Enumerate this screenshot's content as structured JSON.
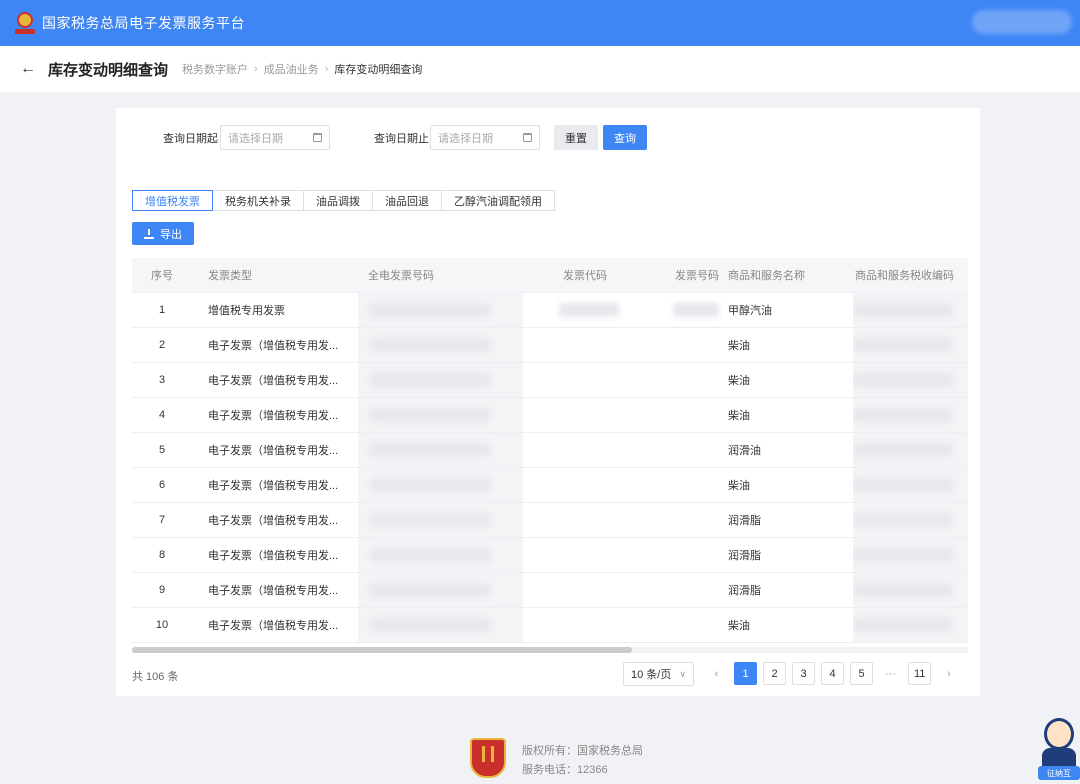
{
  "header": {
    "title": "国家税务总局电子发票服务平台"
  },
  "page": {
    "back_icon": "arrow-left-icon",
    "title": "库存变动明细查询",
    "breadcrumb": [
      "税务数字账户",
      "成品油业务",
      "库存变动明细查询"
    ],
    "breadcrumb_sep": "›"
  },
  "filters": {
    "start_label": "查询日期起",
    "start_placeholder": "请选择日期",
    "end_label": "查询日期止",
    "end_placeholder": "请选择日期",
    "reset_label": "重置",
    "query_label": "查询"
  },
  "tabs": [
    {
      "label": "增值税发票",
      "active": true
    },
    {
      "label": "税务机关补录",
      "active": false
    },
    {
      "label": "油品调拨",
      "active": false
    },
    {
      "label": "油品回退",
      "active": false
    },
    {
      "label": "乙醇汽油调配领用",
      "active": false
    }
  ],
  "export_label": "导出",
  "table": {
    "columns": [
      "序号",
      "发票类型",
      "全电发票号码",
      "发票代码",
      "发票号码",
      "商品和服务名称",
      "商品和服务税收编码"
    ],
    "rows": [
      {
        "idx": "1",
        "type": "增值税专用发票",
        "name": "甲醇汽油"
      },
      {
        "idx": "2",
        "type": "电子发票（增值税专用发...",
        "name": "柴油"
      },
      {
        "idx": "3",
        "type": "电子发票（增值税专用发...",
        "name": "柴油"
      },
      {
        "idx": "4",
        "type": "电子发票（增值税专用发...",
        "name": "柴油"
      },
      {
        "idx": "5",
        "type": "电子发票（增值税专用发...",
        "name": "润滑油"
      },
      {
        "idx": "6",
        "type": "电子发票（增值税专用发...",
        "name": "柴油"
      },
      {
        "idx": "7",
        "type": "电子发票（增值税专用发...",
        "name": "润滑脂"
      },
      {
        "idx": "8",
        "type": "电子发票（增值税专用发...",
        "name": "润滑脂"
      },
      {
        "idx": "9",
        "type": "电子发票（增值税专用发...",
        "name": "润滑脂"
      },
      {
        "idx": "10",
        "type": "电子发票（增值税专用发...",
        "name": "柴油"
      }
    ]
  },
  "pagination": {
    "total": "共 106 条",
    "page_size": "10 条/页",
    "prev": "‹",
    "pages": [
      "1",
      "2",
      "3",
      "4",
      "5"
    ],
    "ellipsis": "···",
    "last": "11",
    "next": "›",
    "current": "1"
  },
  "footer": {
    "copyright": "版权所有：国家税务总局",
    "phone": "服务电话：12366"
  },
  "assistant": {
    "label": "征纳互"
  },
  "colors": {
    "primary": "#3f86f5",
    "background": "#f0f2f5"
  }
}
